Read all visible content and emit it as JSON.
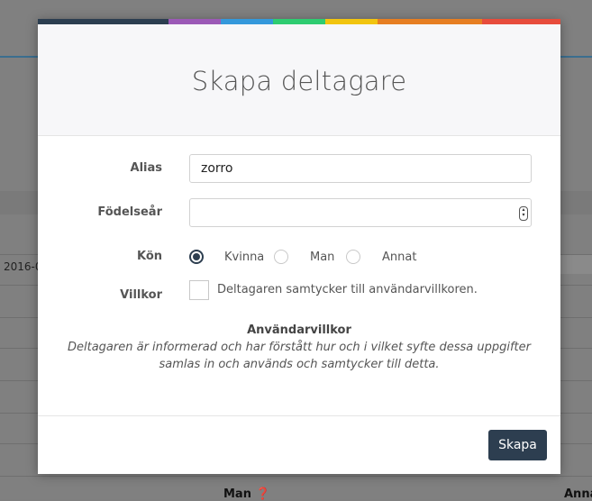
{
  "background": {
    "date_text": "2016-0",
    "column_man": "Man ❓",
    "column_annat": "Annat"
  },
  "modal": {
    "title": "Skapa deltagare",
    "accent_colors": [
      "#2c3e50",
      "#2c3e50",
      "#9b59b6",
      "#3498db",
      "#2ecc71",
      "#f1c40f",
      "#e67e22",
      "#e67e22",
      "#e74c3c"
    ],
    "fields": {
      "alias_label": "Alias",
      "alias_value": "zorro",
      "birthyear_label": "Födelseår",
      "birthyear_value": "",
      "gender_label": "Kön",
      "gender_options": [
        "Kvinna",
        "Man",
        "Annat"
      ],
      "gender_selected": "Kvinna",
      "terms_label": "Villkor",
      "terms_checkbox_text": "Deltagaren samtycker till användarvillkoren.",
      "terms_checked": false
    },
    "terms": {
      "title": "Användarvillkor",
      "text": "Deltagaren är informerad och har förstått hur och i vilket syfte dessa uppgifter samlas in och används och samtycker till detta."
    },
    "footer": {
      "create_button": "Skapa"
    }
  }
}
